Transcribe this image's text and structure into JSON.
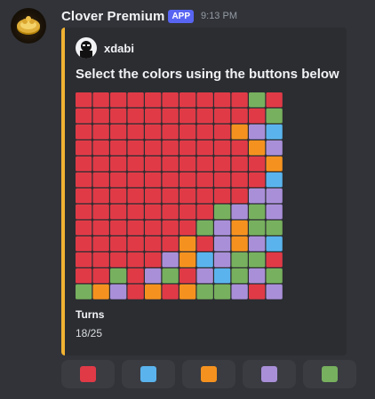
{
  "message": {
    "username": "Clover Premium",
    "badge": "APP",
    "timestamp": "9:13 PM"
  },
  "embed": {
    "accent_color": "#f0b232",
    "author": "xdabi",
    "title": "Select the colors using the buttons below",
    "field_name": "Turns",
    "field_value": "18/25"
  },
  "colors": {
    "R": "#e03a47",
    "B": "#5ab3ed",
    "O": "#f5921f",
    "P": "#a98fd8",
    "G": "#77b05e"
  },
  "board": [
    "RRRRRRRRRRGR",
    "RRRRRRRRRRRG",
    "RRRRRRRRROPB",
    "RRRRRRRRRROP",
    "RRRRRRRRRRRO",
    "RRRRRRRRRRRB",
    "RRRRRRRRRRPP",
    "RRRRRRRRGPGP",
    "RRRRRRRGPOGG",
    "RRRRRRORPOPB",
    "RRRRRPOBPGGR",
    "RRGRPGRPBGPG",
    "GOPROROGGPRP"
  ],
  "buttons": [
    {
      "color": "R",
      "label": "red"
    },
    {
      "color": "B",
      "label": "blue"
    },
    {
      "color": "O",
      "label": "orange"
    },
    {
      "color": "P",
      "label": "purple"
    },
    {
      "color": "G",
      "label": "green"
    }
  ]
}
